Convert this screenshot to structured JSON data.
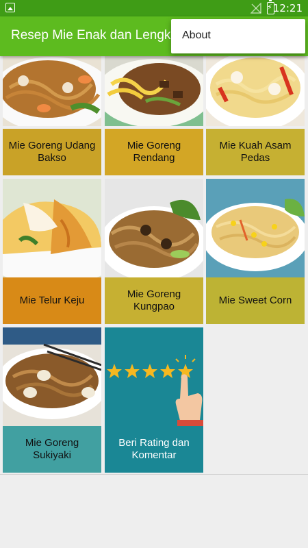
{
  "status_bar": {
    "time": "12:21"
  },
  "app_bar": {
    "title": "Resep Mie  Enak dan Lengkap"
  },
  "menu": {
    "items": [
      "About"
    ]
  },
  "cards": [
    {
      "label": "Mie Goreng Udang Bakso",
      "color": "#c9a227"
    },
    {
      "label": "Mie Goreng Rendang",
      "color": "#d3a625"
    },
    {
      "label": "Mie Kuah Asam Pedas",
      "color": "#c6b032"
    },
    {
      "label": "Mie Telur Keju",
      "color": "#d88a17"
    },
    {
      "label": "Mie Goreng Kungpao",
      "color": "#c6b032"
    },
    {
      "label": "Mie Sweet Corn",
      "color": "#bdb334"
    },
    {
      "label": "Mie Goreng Sukiyaki",
      "color": "#41a0a1"
    },
    {
      "label": "Beri Rating dan Komentar",
      "color": "#1a8795"
    }
  ]
}
